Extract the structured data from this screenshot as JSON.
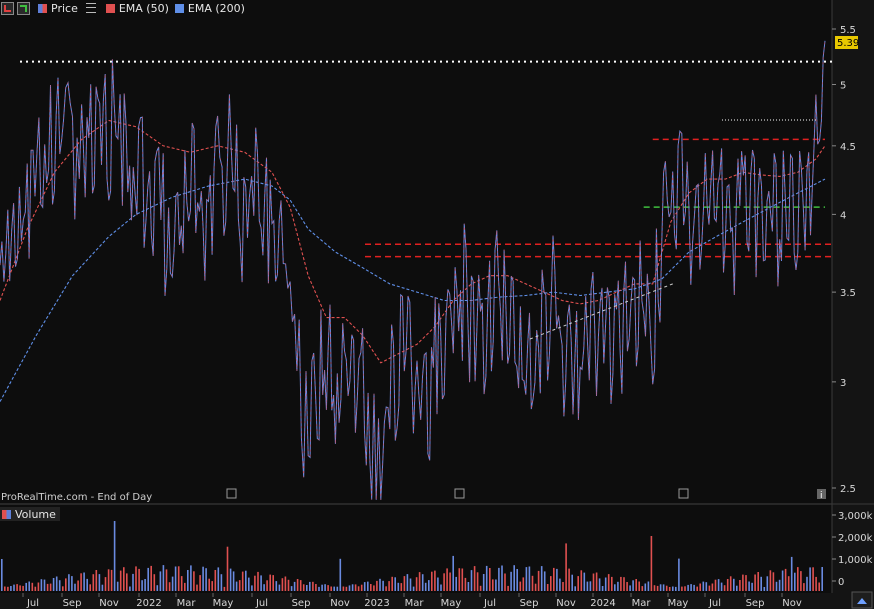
{
  "legend": {
    "price_label": "Price",
    "ema50_label": "EMA (50)",
    "ema200_label": "EMA (200)",
    "price_color": "#5f7fd8",
    "ema50_color": "#e05050",
    "ema200_color": "#5f8fe8"
  },
  "volume_label": "Volume",
  "watermark": "ProRealTime.com - End of Day",
  "last_price": "5.39",
  "chart_data": {
    "type": "line",
    "price_axis": {
      "ticks": [
        "5.5",
        "5",
        "4.5",
        "4",
        "3.5",
        "3",
        "2.5"
      ],
      "tick_values": [
        5.5,
        5.0,
        4.5,
        4.0,
        3.5,
        3.0,
        2.5
      ],
      "scale": "log"
    },
    "volume_axis": {
      "ticks": [
        "3,000k",
        "2,000k",
        "1,000k",
        "0"
      ],
      "tick_values": [
        3000,
        2000,
        1000,
        0
      ]
    },
    "time_axis": [
      "Jul",
      "Sep",
      "Nov",
      "2022",
      "Mar",
      "May",
      "Jul",
      "Sep",
      "Nov",
      "2023",
      "Mar",
      "May",
      "Jul",
      "Sep",
      "Nov",
      "2024",
      "Mar",
      "May",
      "Jul",
      "Sep",
      "Nov"
    ],
    "price_path": [
      [
        0,
        3.9
      ],
      [
        3,
        4.05
      ],
      [
        6,
        4.3
      ],
      [
        9,
        4.6
      ],
      [
        12,
        4.95
      ],
      [
        14,
        5.12
      ],
      [
        15,
        5.05
      ],
      [
        16,
        4.5
      ],
      [
        17,
        4.6
      ],
      [
        18,
        4.75
      ],
      [
        20,
        4.85
      ],
      [
        22,
        4.75
      ],
      [
        24,
        4.9
      ],
      [
        26,
        5.18
      ],
      [
        27,
        4.95
      ],
      [
        29,
        4.55
      ],
      [
        31,
        4.6
      ],
      [
        33,
        4.35
      ],
      [
        35,
        4.45
      ],
      [
        36,
        4.2
      ],
      [
        38,
        4.1
      ],
      [
        40,
        4.4
      ],
      [
        42,
        4.6
      ],
      [
        44,
        4.45
      ],
      [
        46,
        4.2
      ],
      [
        48,
        4.95
      ],
      [
        49,
        4.55
      ],
      [
        51,
        4.7
      ],
      [
        53,
        4.3
      ],
      [
        55,
        4.45
      ],
      [
        56,
        4.55
      ],
      [
        58,
        4.35
      ],
      [
        60,
        4.1
      ],
      [
        62,
        3.95
      ],
      [
        63,
        3.9
      ],
      [
        64,
        3.75
      ],
      [
        65,
        3.55
      ],
      [
        66,
        3.3
      ],
      [
        67,
        3.0
      ],
      [
        68,
        3.05
      ],
      [
        70,
        3.15
      ],
      [
        72,
        3.4
      ],
      [
        74,
        3.2
      ],
      [
        76,
        3.3
      ],
      [
        78,
        3.35
      ],
      [
        80,
        3.2
      ],
      [
        82,
        2.95
      ],
      [
        83,
        2.6
      ],
      [
        84,
        2.85
      ],
      [
        86,
        3.15
      ],
      [
        88,
        3.3
      ],
      [
        90,
        3.35
      ],
      [
        92,
        3.1
      ],
      [
        94,
        3.05
      ],
      [
        96,
        3.3
      ],
      [
        98,
        3.55
      ],
      [
        100,
        3.7
      ],
      [
        102,
        3.75
      ],
      [
        104,
        3.6
      ],
      [
        106,
        3.45
      ],
      [
        108,
        3.6
      ],
      [
        110,
        3.7
      ],
      [
        112,
        3.75
      ],
      [
        114,
        3.5
      ],
      [
        116,
        3.35
      ],
      [
        118,
        3.45
      ],
      [
        120,
        3.6
      ],
      [
        122,
        3.65
      ],
      [
        124,
        3.4
      ],
      [
        126,
        3.3
      ],
      [
        128,
        3.3
      ],
      [
        130,
        3.45
      ],
      [
        132,
        3.55
      ],
      [
        134,
        3.5
      ],
      [
        136,
        3.55
      ],
      [
        138,
        3.55
      ],
      [
        140,
        3.6
      ],
      [
        142,
        3.7
      ],
      [
        144,
        3.6
      ],
      [
        146,
        4.15
      ],
      [
        148,
        4.5
      ],
      [
        150,
        4.4
      ],
      [
        152,
        4.25
      ],
      [
        154,
        4.2
      ],
      [
        156,
        4.35
      ],
      [
        158,
        4.65
      ],
      [
        160,
        4.1
      ],
      [
        162,
        4.2
      ],
      [
        164,
        4.45
      ],
      [
        166,
        4.35
      ],
      [
        168,
        4.2
      ],
      [
        170,
        4.25
      ],
      [
        172,
        4.15
      ],
      [
        174,
        4.35
      ],
      [
        176,
        4.45
      ],
      [
        178,
        4.6
      ],
      [
        180,
        4.65
      ],
      [
        182,
        5.39
      ]
    ],
    "ema50_path": [
      [
        0,
        3.45
      ],
      [
        6,
        3.9
      ],
      [
        12,
        4.3
      ],
      [
        18,
        4.55
      ],
      [
        24,
        4.7
      ],
      [
        30,
        4.65
      ],
      [
        36,
        4.5
      ],
      [
        42,
        4.45
      ],
      [
        48,
        4.5
      ],
      [
        54,
        4.45
      ],
      [
        60,
        4.3
      ],
      [
        64,
        4.05
      ],
      [
        68,
        3.6
      ],
      [
        72,
        3.35
      ],
      [
        76,
        3.35
      ],
      [
        80,
        3.25
      ],
      [
        84,
        3.1
      ],
      [
        88,
        3.15
      ],
      [
        92,
        3.2
      ],
      [
        96,
        3.3
      ],
      [
        100,
        3.45
      ],
      [
        104,
        3.55
      ],
      [
        108,
        3.6
      ],
      [
        112,
        3.6
      ],
      [
        116,
        3.55
      ],
      [
        120,
        3.5
      ],
      [
        124,
        3.45
      ],
      [
        128,
        3.43
      ],
      [
        132,
        3.45
      ],
      [
        136,
        3.5
      ],
      [
        140,
        3.55
      ],
      [
        144,
        3.55
      ],
      [
        148,
        3.95
      ],
      [
        152,
        4.15
      ],
      [
        156,
        4.25
      ],
      [
        160,
        4.25
      ],
      [
        164,
        4.3
      ],
      [
        168,
        4.28
      ],
      [
        172,
        4.27
      ],
      [
        176,
        4.3
      ],
      [
        180,
        4.4
      ],
      [
        182,
        4.5
      ]
    ],
    "ema200_path": [
      [
        0,
        2.9
      ],
      [
        8,
        3.25
      ],
      [
        16,
        3.6
      ],
      [
        24,
        3.85
      ],
      [
        30,
        4.0
      ],
      [
        38,
        4.12
      ],
      [
        46,
        4.2
      ],
      [
        54,
        4.25
      ],
      [
        60,
        4.2
      ],
      [
        64,
        4.1
      ],
      [
        68,
        3.9
      ],
      [
        74,
        3.75
      ],
      [
        80,
        3.65
      ],
      [
        86,
        3.55
      ],
      [
        92,
        3.5
      ],
      [
        98,
        3.45
      ],
      [
        104,
        3.45
      ],
      [
        110,
        3.47
      ],
      [
        116,
        3.48
      ],
      [
        122,
        3.5
      ],
      [
        128,
        3.48
      ],
      [
        134,
        3.5
      ],
      [
        140,
        3.52
      ],
      [
        146,
        3.58
      ],
      [
        152,
        3.75
      ],
      [
        158,
        3.85
      ],
      [
        164,
        3.95
      ],
      [
        170,
        4.05
      ],
      [
        176,
        4.15
      ],
      [
        182,
        4.25
      ]
    ],
    "levels": [
      {
        "value": 5.2,
        "style": "dotted",
        "color": "#ffffff"
      },
      {
        "value": 3.8,
        "style": "dashed",
        "color": "#e02020"
      },
      {
        "value": 3.72,
        "style": "dashed",
        "color": "#e02020"
      },
      {
        "value": 4.55,
        "style": "dashed",
        "color": "#e02020",
        "from": 144,
        "to": 182
      },
      {
        "value": 4.05,
        "style": "dashed",
        "color": "#3fbf3f",
        "from": 142,
        "to": 182
      }
    ]
  }
}
